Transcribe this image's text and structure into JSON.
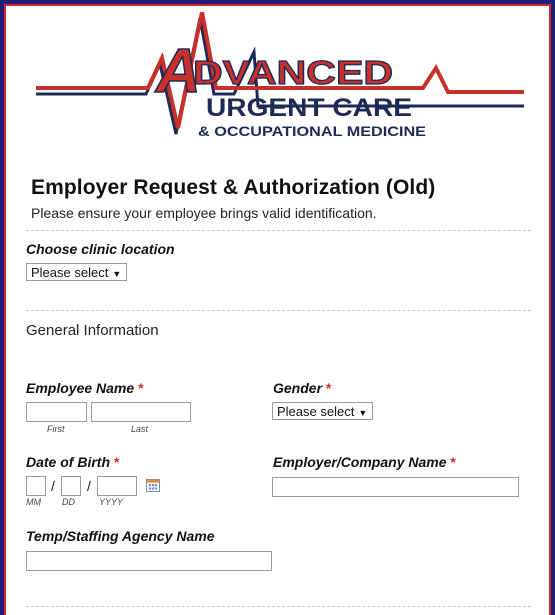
{
  "logo": {
    "line1": "ADVANCED",
    "line2": "URGENT CARE",
    "line3": "& OCCUPATIONAL MEDICINE"
  },
  "form": {
    "title": "Employer Request & Authorization (Old)",
    "subtitle": "Please ensure your employee brings valid identification."
  },
  "clinic": {
    "label": "Choose clinic location",
    "select_value": "Please select"
  },
  "section": {
    "general": "General Information"
  },
  "employee_name": {
    "label": "Employee Name",
    "required_mark": "*",
    "first_sublabel": "First",
    "last_sublabel": "Last"
  },
  "gender": {
    "label": "Gender",
    "required_mark": "*",
    "select_value": "Please select"
  },
  "dob": {
    "label": "Date of Birth",
    "required_mark": "*",
    "separator": "/",
    "mm": "MM",
    "dd": "DD",
    "yyyy": "YYYY"
  },
  "employer": {
    "label": "Employer/Company Name",
    "required_mark": "*"
  },
  "agency": {
    "label": "Temp/Staffing Agency Name"
  },
  "colors": {
    "frame_outer": "#1f1f7a",
    "frame_border": "#d42a2a",
    "logo_red": "#c8302c",
    "logo_navy": "#1c2a55",
    "required": "#d42a2a"
  }
}
